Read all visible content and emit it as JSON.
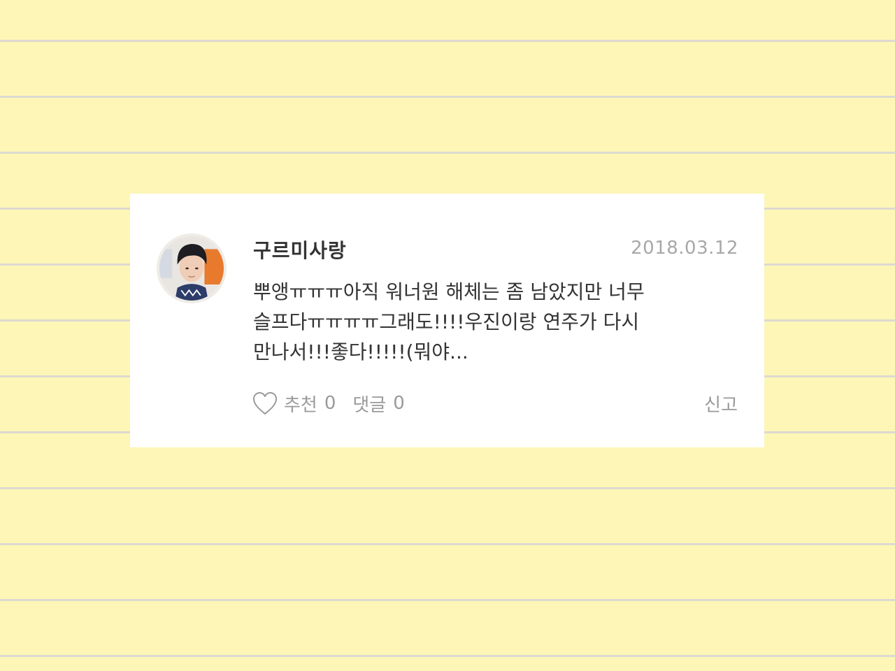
{
  "post": {
    "username": "구르미사랑",
    "date": "2018.03.12",
    "content": "뿌앵ㅠㅠㅠ아직 워너원 해체는 좀 남았지만 너무\n슬프다ㅠㅠㅠㅠ그래도!!!!우진이랑 연주가 다시\n만나서!!!좋다!!!!!(뭐야..."
  },
  "actions": {
    "like_label": "추천",
    "like_count": "0",
    "reply_label": "댓글",
    "reply_count": "0",
    "report_label": "신고"
  },
  "icons": {
    "like": "heart-outline-icon",
    "avatar": "user-avatar"
  },
  "colors": {
    "background": "#fdf6b6",
    "card": "#ffffff",
    "text": "#333333",
    "muted": "#9a9a9a"
  }
}
